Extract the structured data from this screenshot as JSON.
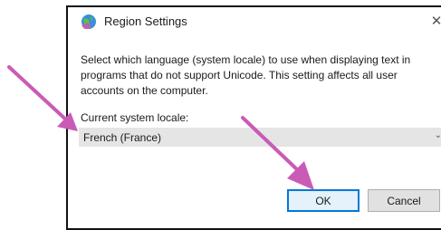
{
  "window": {
    "title": "Region Settings",
    "close_glyph": "✕"
  },
  "dialog": {
    "description": "Select which language (system locale) to use when displaying text in programs that do not support Unicode. This setting affects all user accounts on the computer.",
    "locale_label": "Current system locale:",
    "locale_value": "French (France)",
    "chevron_glyph": "⌄"
  },
  "buttons": {
    "ok_label": "OK",
    "cancel_label": "Cancel"
  },
  "icons": {
    "app": "globe-icon",
    "arrow": "annotation-arrow"
  },
  "colors": {
    "arrow": "#c95bb7",
    "ok_border": "#0078d7",
    "select_bg": "#e5e5e5"
  }
}
